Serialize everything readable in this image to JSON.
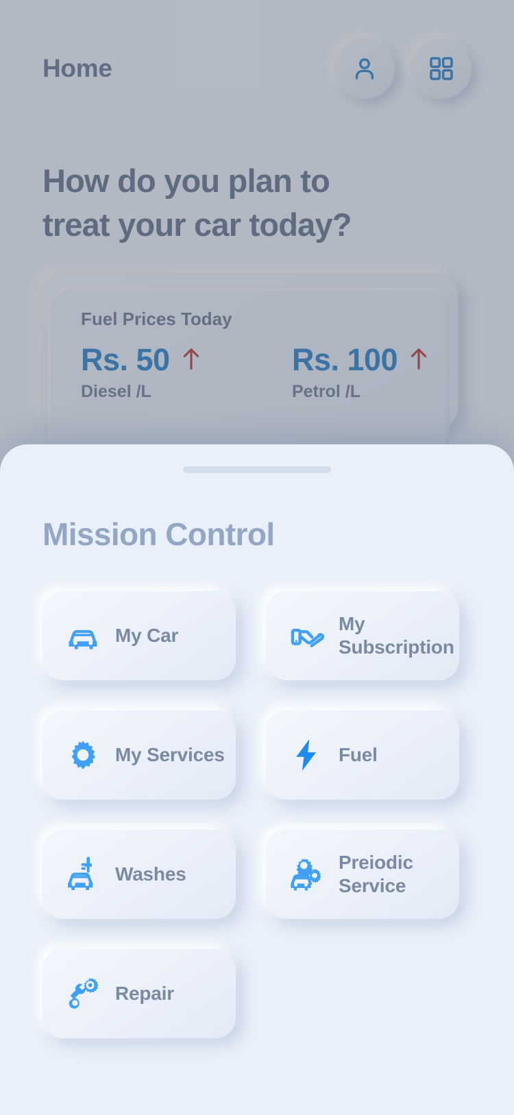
{
  "header": {
    "title": "Home",
    "profile_button": "profile",
    "grid_button": "apps"
  },
  "hero": {
    "line1": "How do you plan to",
    "line2": "treat your car today?"
  },
  "fuel_card": {
    "title": "Fuel Prices Today",
    "entries": [
      {
        "price": "Rs. 50",
        "label": "Diesel /L",
        "trend": "up"
      },
      {
        "price": "Rs. 100",
        "label": "Petrol /L",
        "trend": "up"
      }
    ]
  },
  "sheet": {
    "title": "Mission Control",
    "tiles": [
      {
        "label": "My Car",
        "icon": "car-icon"
      },
      {
        "label": "My Subscription",
        "icon": "hand-card-icon"
      },
      {
        "label": "My Services",
        "icon": "gear-icon"
      },
      {
        "label": "Fuel",
        "icon": "bolt-icon"
      },
      {
        "label": "Washes",
        "icon": "car-wash-icon"
      },
      {
        "label": "Preiodic Service",
        "icon": "car-gears-icon"
      },
      {
        "label": "Repair",
        "icon": "wrench-gears-icon"
      }
    ]
  },
  "colors": {
    "accent_blue": "#1f7ac4",
    "tile_icon_blue": "#3fa0f5",
    "trend_up_red": "#b8302b",
    "heading_slate": "#5f6d84",
    "sheet_title": "#93a6c4",
    "tile_label": "#7b8aa3",
    "sheet_bg": "#e9f0fa"
  }
}
